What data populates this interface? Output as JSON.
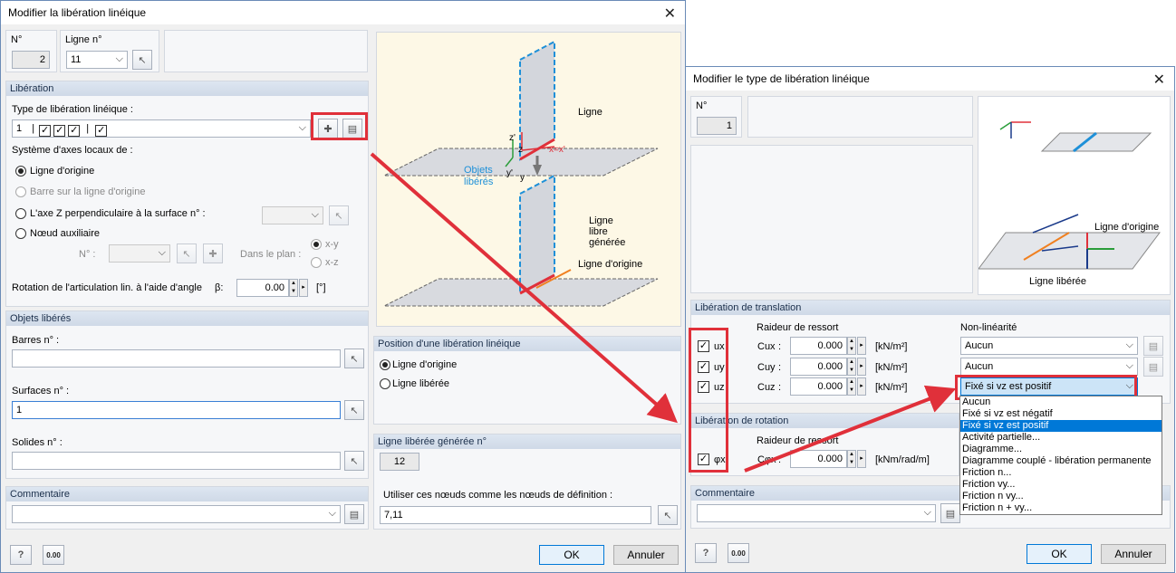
{
  "left": {
    "title": "Modifier la libération linéique",
    "no_label": "N°",
    "no_value": "2",
    "line_label": "Ligne n°",
    "line_value": "11",
    "lib_header": "Libération",
    "type_label": "Type de libération linéique :",
    "type_value": "1",
    "axes_label": "Système d'axes locaux de :",
    "opt1": "Ligne d'origine",
    "opt2": "Barre sur la ligne d'origine",
    "opt3": "L'axe Z perpendiculaire à la surface n° :",
    "opt4": "Nœud auxiliaire",
    "node_label": "N° :",
    "plane_label": "Dans le plan :",
    "plane1": "x-y",
    "plane2": "x-z",
    "rot_label": "Rotation de l'articulation lin. à l'aide d'angle",
    "beta": "β:",
    "rot_value": "0.00",
    "rot_unit": "[°]",
    "obj_header": "Objets libérés",
    "bars_label": "Barres n° :",
    "bars_value": "",
    "surf_label": "Surfaces n° :",
    "surf_value": "1",
    "solid_label": "Solides n° :",
    "solid_value": "",
    "pos_header": "Position d'une libération linéique",
    "pos1": "Ligne d'origine",
    "pos2": "Ligne libérée",
    "gen_header": "Ligne libérée générée n°",
    "gen_value": "12",
    "use_nodes_label": "Utiliser ces nœuds comme les nœuds de définition :",
    "use_nodes_value": "7,11",
    "comment_header": "Commentaire",
    "ok": "OK",
    "cancel": "Annuler",
    "fig_ligne": "Ligne",
    "fig_objets": "Objets\nlibérés",
    "fig_libre": "Ligne\nlibre\ngénérée",
    "fig_orig": "Ligne d'origine",
    "fig_xx": "x=x'",
    "fig_z": "z'",
    "fig_z2": "z",
    "fig_y": "y'",
    "fig_y2": "y",
    "calc_icon": "0.00"
  },
  "right": {
    "title": "Modifier le type de libération linéique",
    "no_label": "N°",
    "no_value": "1",
    "trans_header": "Libération de translation",
    "spring_label": "Raideur de ressort",
    "nonlin_label": "Non-linéarité",
    "ux": "ux",
    "uy": "uy",
    "uz": "uz",
    "cux": "Cux",
    "cuy": "Cuy",
    "cuz": "Cuz",
    "colon": ":",
    "v1": "0.000",
    "v2": "0.000",
    "v3": "0.000",
    "unit": "[kN/m²]",
    "nl1": "Aucun",
    "nl2": "Aucun",
    "nl3": "Fixé si vz est positif",
    "rot_header": "Libération de rotation",
    "rot_spring": "Raideur de ressort",
    "phix": "φx",
    "cphi": "Cφx",
    "rv": "0.000",
    "runit": "[kNm/rad/m]",
    "comment_header": "Commentaire",
    "ok": "OK",
    "cancel": "Annuler",
    "dropdown": [
      "Aucun",
      "Fixé si vz est négatif",
      "Fixé si vz est positif",
      "Activité partielle...",
      "Diagramme...",
      "Diagramme couplé - libération permanente",
      "Friction n...",
      "Friction vy...",
      "Friction n vy...",
      "Friction n + vy..."
    ],
    "fig_orig": "Ligne d'origine",
    "fig_lib": "Ligne libérée",
    "calc_icon": "0.00"
  },
  "colors": {
    "accent": "#e0303a",
    "blue": "#0078d7",
    "title_bg": "#ffffff"
  }
}
